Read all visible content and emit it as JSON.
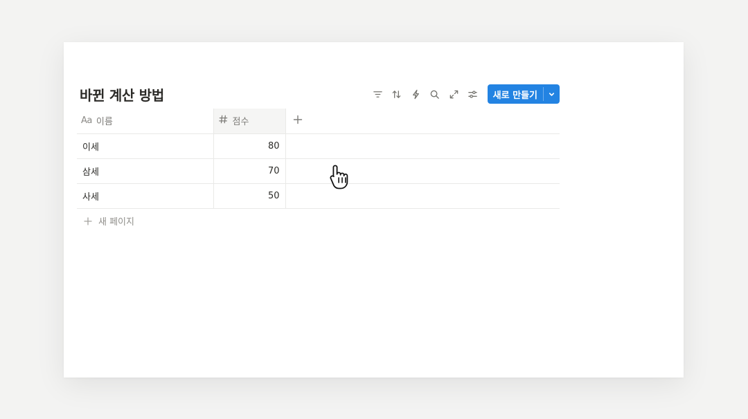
{
  "database": {
    "title": "바뀐 계산 방법",
    "new_button_label": "새로 만들기",
    "toolbar_icons": [
      "filter-icon",
      "sort-icon",
      "lightning-icon",
      "search-icon",
      "expand-icon",
      "settings-icon"
    ],
    "accent_color": "#2383e2",
    "columns": [
      {
        "label": "이름",
        "icon": "Aa"
      },
      {
        "label": "점수",
        "icon": "hash-icon"
      }
    ],
    "rows": [
      {
        "name": "이세",
        "score": "80"
      },
      {
        "name": "삼세",
        "score": "70"
      },
      {
        "name": "사세",
        "score": "50"
      }
    ],
    "new_page_label": "새 페이지"
  }
}
